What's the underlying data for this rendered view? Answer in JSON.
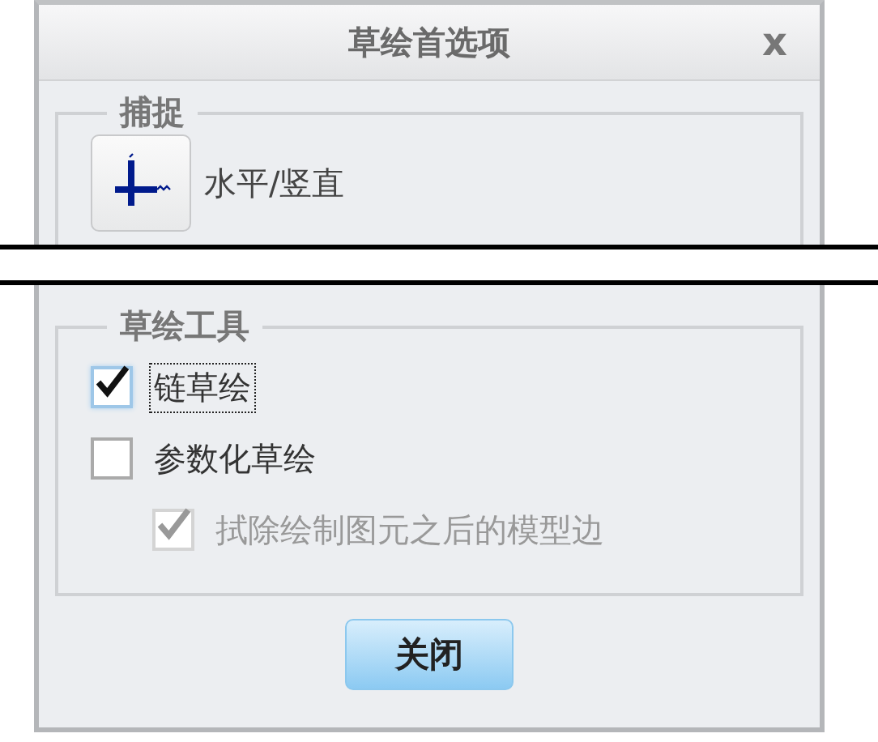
{
  "window": {
    "title": "草绘首选项",
    "close": "x"
  },
  "snap": {
    "legend": "捕捉",
    "label": "水平/竖直",
    "selected": false
  },
  "tools": {
    "legend": "草绘工具",
    "options": [
      {
        "label": "链草绘",
        "checked": true,
        "disabled": false,
        "focused": true
      },
      {
        "label": "参数化草绘",
        "checked": false,
        "disabled": false,
        "focused": false,
        "children": [
          {
            "label": "拭除绘制图元之后的模型边",
            "checked": true,
            "disabled": true,
            "focused": false
          }
        ]
      }
    ]
  },
  "buttons": [
    "关闭"
  ]
}
